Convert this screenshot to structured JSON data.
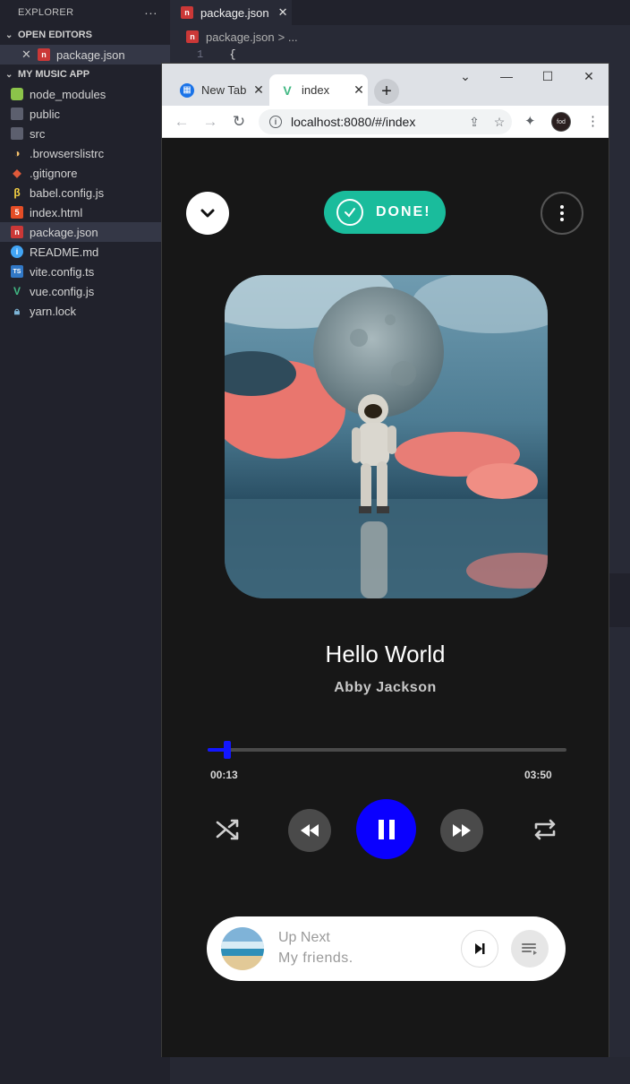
{
  "explorer": {
    "title": "EXPLORER",
    "more": "···",
    "open_editors_label": "OPEN EDITORS",
    "open_file": "package.json",
    "project_label": "MY MUSIC APP",
    "files": [
      "node_modules",
      "public",
      "src",
      ".browserslistrc",
      ".gitignore",
      "babel.config.js",
      "index.html",
      "package.json",
      "README.md",
      "vite.config.ts",
      "vue.config.js",
      "yarn.lock"
    ]
  },
  "editor": {
    "tab_label": "package.json",
    "breadcrumb": "package.json",
    "breadcrumb_more": "> ...",
    "line_no": "1",
    "line_text": "{"
  },
  "browser": {
    "tab1_label": "New Tab",
    "tab2_label": "index",
    "url": "localhost:8080/#/index",
    "profile_label": "fod"
  },
  "player": {
    "status_label": "DONE!",
    "song_title": "Hello World",
    "artist": "Abby Jackson",
    "current_time": "00:13",
    "total_time": "03:50",
    "progress": 0.056,
    "accent_color": "#0a00ff",
    "done_color": "#1abc9c"
  },
  "up_next": {
    "label": "Up Next",
    "song": "My friends."
  }
}
